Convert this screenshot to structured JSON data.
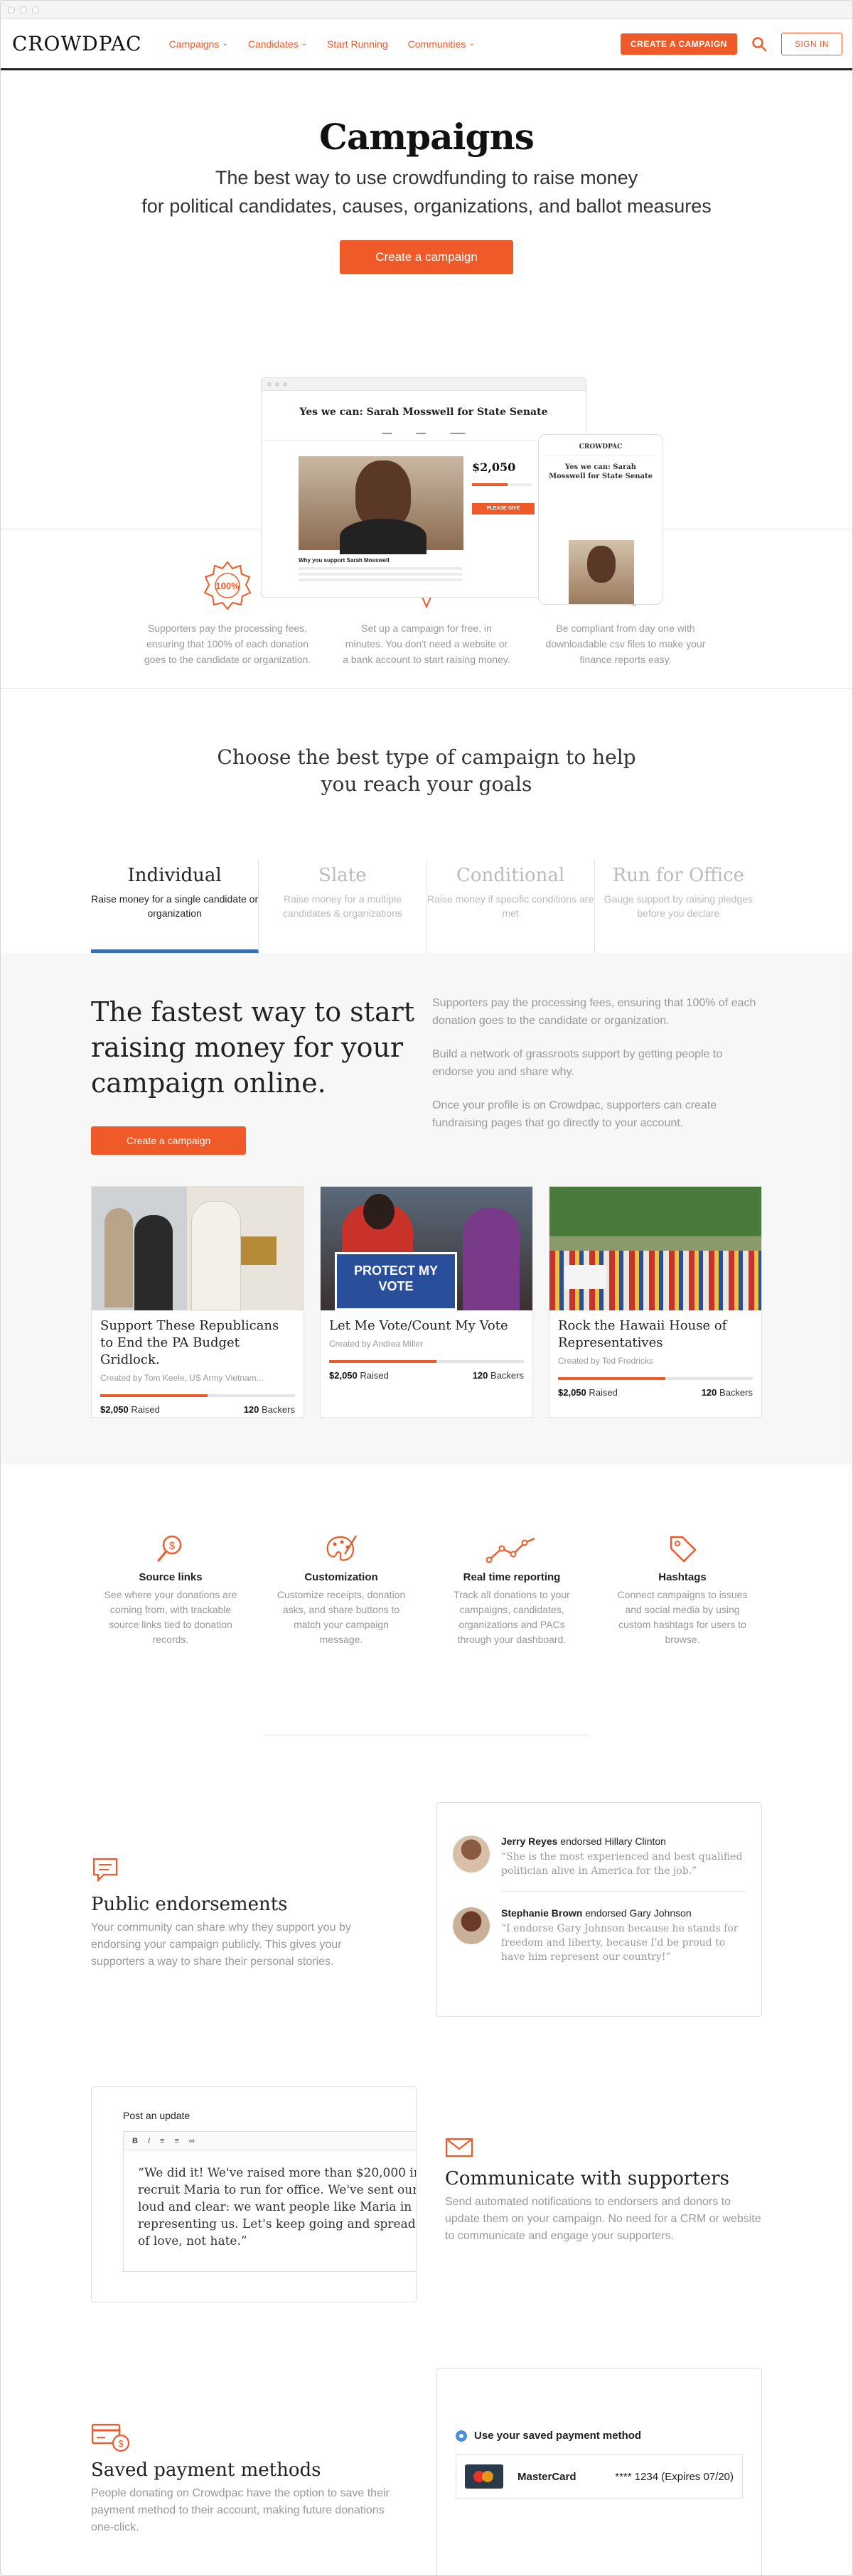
{
  "nav": {
    "logo": "CROWDPAC",
    "links": [
      {
        "label": "Campaigns",
        "dropdown": true
      },
      {
        "label": "Candidates",
        "dropdown": true
      },
      {
        "label": "Start Running",
        "dropdown": false
      },
      {
        "label": "Communities",
        "dropdown": true
      }
    ],
    "create_button": "CREATE A CAMPAIGN",
    "search_icon": "search-icon",
    "signin_button": "SIGN IN"
  },
  "hero": {
    "title": "Campaigns",
    "subtitle_line1": "The best way to use crowdfunding to raise money",
    "subtitle_line2": "for political candidates, causes, organizations, and ballot measures",
    "cta": "Create a campaign",
    "mock": {
      "title": "Yes we can: Sarah Mosswell for State Senate",
      "amount": "$2,050",
      "pledge_button": "PLEASE GIVE",
      "why": "Why you support Sarah Mosswell",
      "phone_logo": "CROWDPAC",
      "phone_title": "Yes we can: Sarah Mosswell for State Senate"
    }
  },
  "features": [
    {
      "icon": "badge-100-icon",
      "badge_text": "100%",
      "text": "Supporters pay the processing fees, ensuring that 100% of each donation goes to the candidate or organization."
    },
    {
      "icon": "rocket-icon",
      "text": "Set up a campaign for free, in minutes. You don't need a website or a bank account to start raising money."
    },
    {
      "icon": "report-icon",
      "text": "Be compliant from day one with downloadable csv files to make your finance reports easy."
    }
  ],
  "choose": {
    "heading_line1": "Choose the best type of campaign to help",
    "heading_line2": "you reach your goals",
    "tabs": [
      {
        "title": "Individual",
        "desc": "Raise money for a single candidate or organization",
        "active": true
      },
      {
        "title": "Slate",
        "desc": "Raise money for a multiple candidates & organizations",
        "active": false
      },
      {
        "title": "Conditional",
        "desc": "Raise money if specific conditions are met",
        "active": false
      },
      {
        "title": "Run for Office",
        "desc": "Gauge support by raising pledges before you declare",
        "active": false
      }
    ]
  },
  "panel": {
    "heading": "The fastest way to start raising money for your campaign online.",
    "paragraphs": [
      "Supporters pay the processing fees, ensuring that 100% of each donation goes to the candidate or organization.",
      "Build a network of grassroots support by getting people to endorse you and share why.",
      "Once your profile is on Crowdpac, supporters can create fundraising pages that go directly to your account."
    ],
    "cta": "Create a campaign",
    "cards": [
      {
        "title": "Support These Republicans to End the PA Budget Gridlock.",
        "by": "Created by Tom Keele, US Army Vietnam...",
        "raised": "$2,050",
        "raised_label": "Raised",
        "backers": "120",
        "backers_label": "Backers",
        "progress": 0.55
      },
      {
        "title": "Let Me Vote/Count My Vote",
        "by": "Created by Andrea Miller",
        "raised": "$2,050",
        "raised_label": "Raised",
        "backers": "120",
        "backers_label": "Backers",
        "progress": 0.55,
        "sign_text": "PROTECT MY VOTE"
      },
      {
        "title": "Rock the Hawaii House of Representatives",
        "by": "Created by Ted Fredricks",
        "raised": "$2,050",
        "raised_label": "Raised",
        "backers": "120",
        "backers_label": "Backers",
        "progress": 0.55
      }
    ]
  },
  "tools": [
    {
      "icon": "link-search-icon",
      "title": "Source links",
      "text": "See where your donations are coming from, with trackable source links tied to donation records."
    },
    {
      "icon": "palette-icon",
      "title": "Customization",
      "text": "Customize receipts, donation asks, and share buttons to match your campaign message."
    },
    {
      "icon": "line-chart-icon",
      "title": "Real time reporting",
      "text": "Track all donations to your campaigns, candidates, organizations and PACs through your dashboard."
    },
    {
      "icon": "tag-icon",
      "title": "Hashtags",
      "text": "Connect campaigns to issues and social media by using custom hashtags for users to browse."
    }
  ],
  "endorsements": {
    "title": "Public endorsements",
    "text": "Your community can share why they support you by endorsing your campaign publicly. This gives your supporters a way to share their personal stories.",
    "items": [
      {
        "name": "Jerry Reyes",
        "verb": "endorsed",
        "target": "Hillary Clinton",
        "quote": "“She is the most experienced and best qualified politician alive in America for the job.”"
      },
      {
        "name": "Stephanie Brown",
        "verb": "endorsed",
        "target": "Gary Johnson",
        "quote": "“I endorse Gary Johnson because he stands for freedom and liberty, because I'd be proud to have him represent our country!”"
      }
    ]
  },
  "communicate": {
    "title": "Communicate with supporters",
    "text": "Send automated notifications to endorsers and donors to update them on your campaign. No need for a CRM or website to communicate and engage your supporters.",
    "update_label": "Post an update",
    "toolbar": [
      "B",
      "I",
      "≡",
      "≡",
      "∞"
    ],
    "update_lines": [
      "“We did it! We've raised more than $20,000 in",
      "recruit Maria to run for office. We've sent our m",
      "loud and clear: we want people like Maria in offi",
      "representing us. Let's keep going and spread ou",
      "of love, not hate.”"
    ]
  },
  "payment": {
    "title": "Saved payment methods",
    "text": "People donating on Crowdpac have the option to save their payment method to their account, making future donations one-click.",
    "radio_label": "Use your saved payment method",
    "card_name": "MasterCard",
    "card_number": "**** 1234 (Expires 07/20)"
  },
  "colors": {
    "accent": "#f05a28",
    "active_tab": "#3a6db4",
    "muted_text": "#999999"
  }
}
